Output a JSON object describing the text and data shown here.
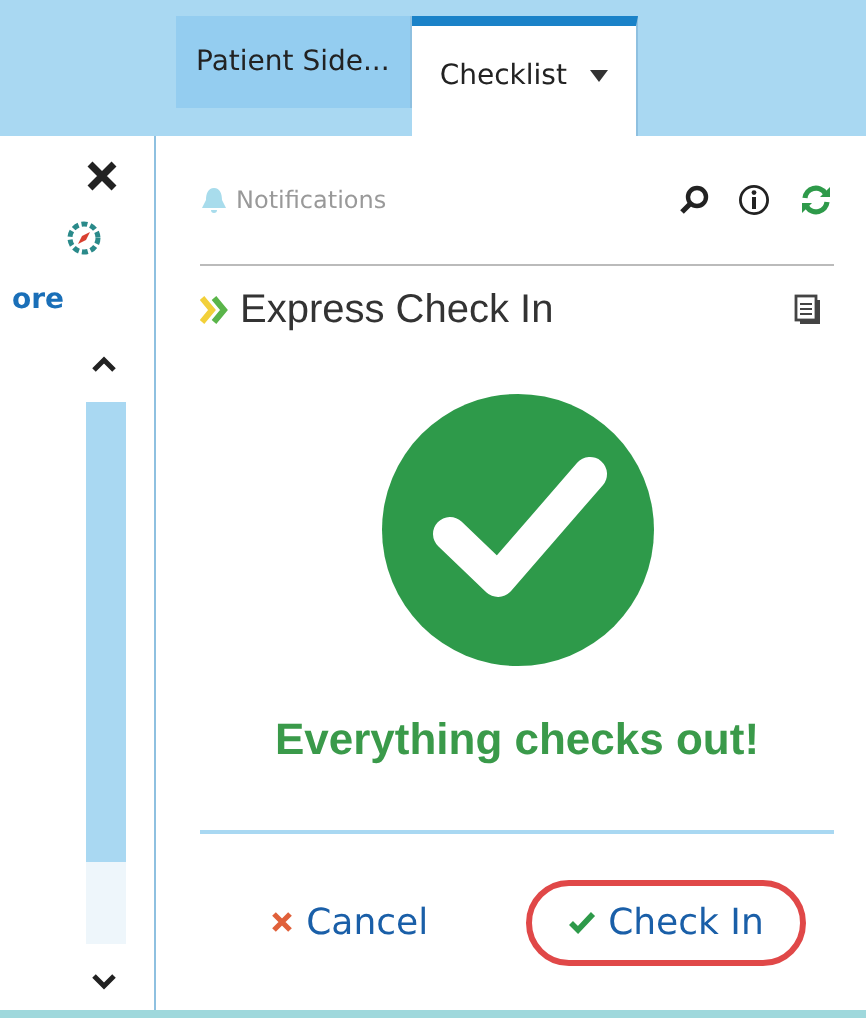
{
  "tabs": [
    {
      "label": "Patient Side...",
      "selected": false,
      "dropdown": false
    },
    {
      "label": "Checklist",
      "selected": true,
      "dropdown": true
    }
  ],
  "sidebar": {
    "more_label": "ore"
  },
  "toolbar": {
    "notifications": "Notifications"
  },
  "section": {
    "title": "Express Check In"
  },
  "result": {
    "message": "Everything checks out!"
  },
  "buttons": [
    {
      "kind": "cancel",
      "label": "Cancel",
      "highlighted": false
    },
    {
      "kind": "confirm",
      "label": "Check In",
      "highlighted": true
    }
  ]
}
